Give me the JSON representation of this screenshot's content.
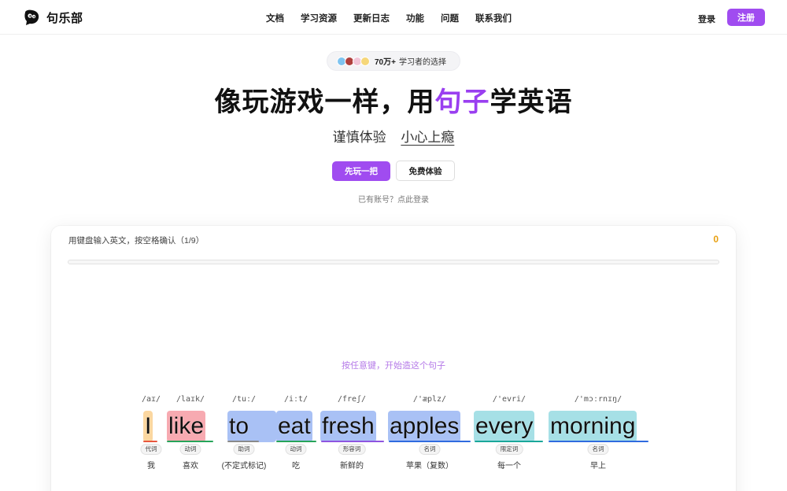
{
  "brand": {
    "name": "句乐部"
  },
  "nav": {
    "links": [
      "文档",
      "学习资源",
      "更新日志",
      "功能",
      "问题",
      "联系我们"
    ],
    "login_label": "登录",
    "register_label": "注册"
  },
  "hero": {
    "badge_count": "70万+",
    "badge_text": "学习者的选择",
    "title_pre": "像玩游戏一样，用",
    "title_accent": "句子",
    "title_post": "学英语",
    "sub_left": "谨慎体验",
    "sub_right": "小心上瘾",
    "cta_primary": "先玩一把",
    "cta_secondary": "免费体验",
    "hint_login": "已有账号？点此登录"
  },
  "practice": {
    "instruction": "用键盘输入英文，按空格确认（1/9）",
    "score": "0",
    "start_hint": "按任意键，开始造这个句子",
    "words": [
      {
        "text": "I",
        "ipa": "/aɪ/",
        "pos": "代词",
        "gloss": "我"
      },
      {
        "text": "like",
        "ipa": "/laɪk/",
        "pos": "动词",
        "gloss": "喜欢"
      },
      {
        "text": "to",
        "ipa": "/tuː/",
        "pos": "助词",
        "gloss": "(不定式标记)"
      },
      {
        "text": "eat",
        "ipa": "/iːt/",
        "pos": "动词",
        "gloss": "吃"
      },
      {
        "text": "fresh",
        "ipa": "/freʃ/",
        "pos": "形容词",
        "gloss": "新鲜的"
      },
      {
        "text": "apples",
        "ipa": "/'æplz/",
        "pos": "名词",
        "gloss": "苹果（复数）"
      },
      {
        "text": "every",
        "ipa": "/'evri/",
        "pos": "限定词",
        "gloss": "每一个"
      },
      {
        "text": "morning",
        "ipa": "/'mɔːrnɪŋ/",
        "pos": "名词",
        "gloss": "早上"
      }
    ]
  },
  "colors": {
    "accent": "#a04cf0",
    "score": "#e8a010"
  }
}
